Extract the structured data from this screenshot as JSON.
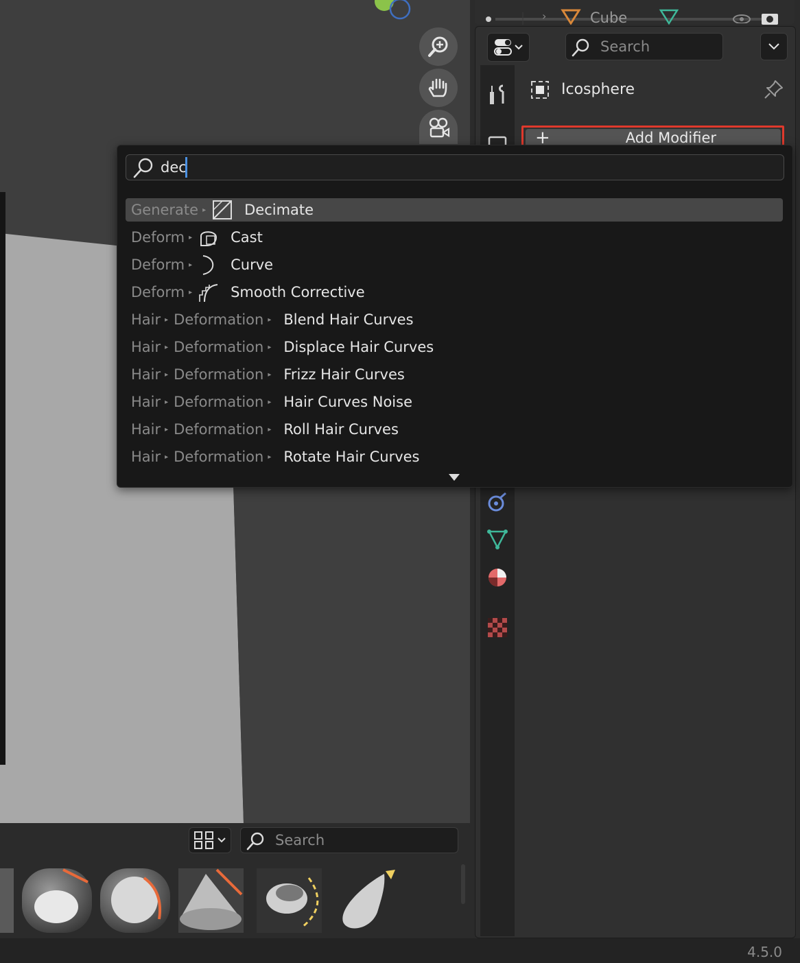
{
  "outliner": {
    "object_name": "Cube"
  },
  "properties": {
    "search_placeholder": "Search",
    "object_name": "Icosphere",
    "add_modifier_label": "Add Modifier"
  },
  "popup": {
    "query": "dec",
    "results": [
      {
        "path": [
          "Generate"
        ],
        "icon": "decimate-icon",
        "name": "Decimate"
      },
      {
        "path": [
          "Deform"
        ],
        "icon": "cast-icon",
        "name": "Cast"
      },
      {
        "path": [
          "Deform"
        ],
        "icon": "curve-icon",
        "name": "Curve"
      },
      {
        "path": [
          "Deform"
        ],
        "icon": "smooth-corrective-icon",
        "name": "Smooth Corrective"
      },
      {
        "path": [
          "Hair",
          "Deformation"
        ],
        "icon": "",
        "name": "Blend Hair Curves"
      },
      {
        "path": [
          "Hair",
          "Deformation"
        ],
        "icon": "",
        "name": "Displace Hair Curves"
      },
      {
        "path": [
          "Hair",
          "Deformation"
        ],
        "icon": "",
        "name": "Frizz Hair Curves"
      },
      {
        "path": [
          "Hair",
          "Deformation"
        ],
        "icon": "",
        "name": "Hair Curves Noise"
      },
      {
        "path": [
          "Hair",
          "Deformation"
        ],
        "icon": "",
        "name": "Roll Hair Curves"
      },
      {
        "path": [
          "Hair",
          "Deformation"
        ],
        "icon": "",
        "name": "Rotate Hair Curves"
      }
    ]
  },
  "asset_shelf": {
    "search_placeholder": "Search"
  },
  "status_bar": {
    "version": "4.5.0"
  },
  "colors": {
    "highlight_outline": "#e0392c",
    "active_row": "#474747",
    "cursor": "#4a90e2"
  }
}
